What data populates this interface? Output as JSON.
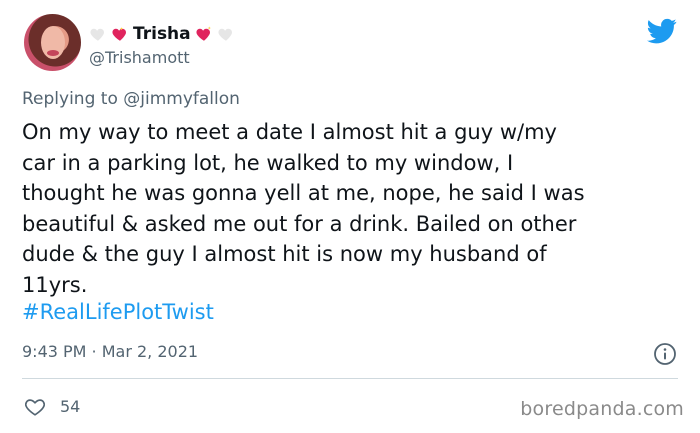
{
  "tweet": {
    "display_name": "Trisha",
    "handle": "@Trishamott",
    "replying_prefix": "Replying to ",
    "replying_to": "@jimmyfallon",
    "body": "On my way to meet a date I almost hit a guy w/my\ncar in a parking lot, he walked to my window, I\nthought he was gonna yell at me, nope, he said I was\nbeautiful & asked me out for a drink. Bailed on other\ndude & the guy I almost hit is now my husband of\n11yrs.",
    "hashtag": "#RealLifePlotTwist",
    "timestamp": "9:43 PM · Mar 2, 2021",
    "like_count": "54"
  },
  "watermark": "boredpanda.com",
  "colors": {
    "twitter_blue": "#1d9bf0",
    "secondary_text": "#536471",
    "heart_pink": "#e0245e",
    "heart_white": "#e6e6e6"
  },
  "icons": {
    "name_decoration_left": [
      "white-heart-icon",
      "sparkling-heart-icon"
    ],
    "name_decoration_right": [
      "sparkling-heart-icon",
      "white-heart-icon"
    ],
    "brand": "twitter-bird-icon",
    "info": "info-icon",
    "like": "heart-outline-icon"
  }
}
